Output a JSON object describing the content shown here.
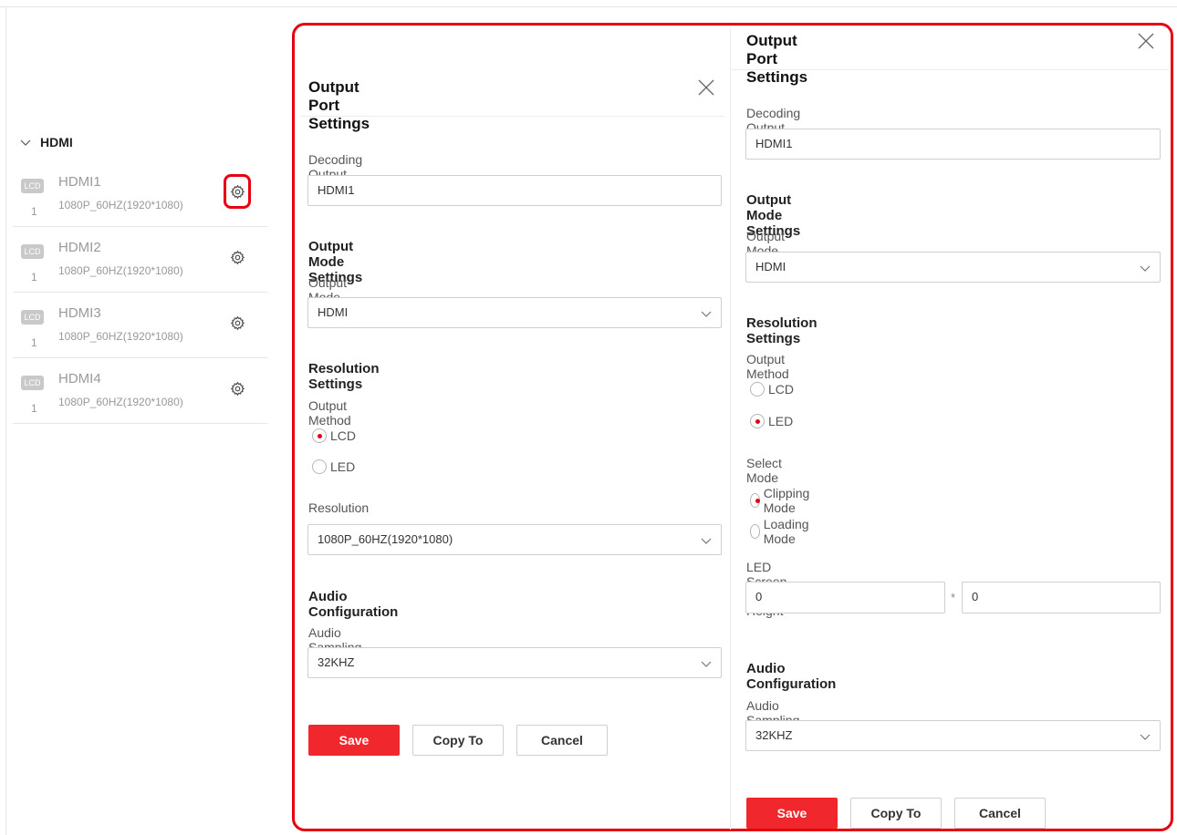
{
  "list": {
    "group_label": "HDMI",
    "ports": [
      {
        "icon_text": "LCD",
        "index": "1",
        "name": "HDMI1",
        "resolution": "1080P_60HZ(1920*1080)"
      },
      {
        "icon_text": "LCD",
        "index": "1",
        "name": "HDMI2",
        "resolution": "1080P_60HZ(1920*1080)"
      },
      {
        "icon_text": "LCD",
        "index": "1",
        "name": "HDMI3",
        "resolution": "1080P_60HZ(1920*1080)"
      },
      {
        "icon_text": "LCD",
        "index": "1",
        "name": "HDMI4",
        "resolution": "1080P_60HZ(1920*1080)"
      }
    ]
  },
  "left_panel": {
    "title": "Output Port Settings",
    "decoding_label": "Decoding Output Name",
    "decoding_value": "HDMI1",
    "output_mode_section": "Output Mode Settings",
    "output_mode_label": "Output Mode",
    "output_mode_value": "HDMI",
    "resolution_section": "Resolution Settings",
    "output_method_label": "Output Method",
    "radio_lcd": "LCD",
    "radio_led": "LED",
    "resolution_label": "Resolution",
    "resolution_value": "1080P_60HZ(1920*1080)",
    "audio_section": "Audio Configuration",
    "audio_rate_label": "Audio Sampling Rate",
    "audio_rate_value": "32KHZ",
    "save": "Save",
    "copy_to": "Copy To",
    "cancel": "Cancel"
  },
  "right_panel": {
    "title": "Output Port Settings",
    "decoding_label": "Decoding Output Name",
    "decoding_value": "HDMI1",
    "output_mode_section": "Output Mode Settings",
    "output_mode_label": "Output Mode",
    "output_mode_value": "HDMI",
    "resolution_section": "Resolution Settings",
    "output_method_label": "Output Method",
    "radio_lcd": "LCD",
    "radio_led": "LED",
    "select_mode_label": "Select Mode",
    "radio_clipping": "Clipping Mode",
    "radio_loading": "Loading Mode",
    "led_size_label": "LED Screen Width × Height",
    "led_width_value": "0",
    "led_height_value": "0",
    "led_separator": "*",
    "audio_section": "Audio Configuration",
    "audio_rate_label": "Audio Sampling Rate",
    "audio_rate_value": "32KHZ",
    "save": "Save",
    "copy_to": "Copy To",
    "cancel": "Cancel"
  },
  "colors": {
    "accent": "#e60012",
    "primary_button": "#f0282d"
  },
  "icons": {
    "gear": "gear-icon",
    "close": "close-icon",
    "chevron": "chevron-down-icon",
    "monitor": "lcd-icon"
  }
}
